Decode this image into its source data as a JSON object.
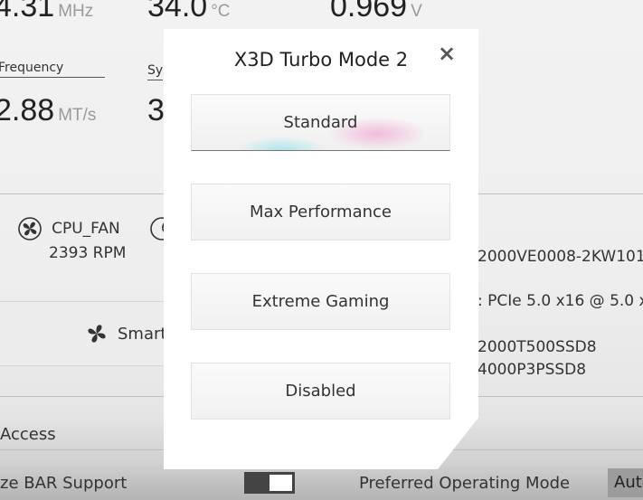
{
  "background": {
    "top_values": [
      {
        "value": "4.31",
        "unit": "MHz"
      },
      {
        "value": "34.0",
        "unit": "°C"
      },
      {
        "value": "0.969",
        "unit": "V"
      }
    ],
    "frequency_label": "Frequency",
    "frequency_value": "2.88",
    "frequency_unit": "MT/s",
    "sy_label": "Sy",
    "sy_value": "3",
    "fan": {
      "name": "CPU_FAN",
      "rpm": "2393 RPM"
    },
    "storage": {
      "line1": "2000VE0008-2KW101",
      "line2": ": PCIe 5.0 x16 @ 5.0 x",
      "line3": "2000T500SSD8",
      "line4": "4000P3PSSD8"
    },
    "smart_fan_label": "Smart",
    "access_label": "Access",
    "resize_bar_label": "ze BAR Support",
    "preferred_mode_label": "Preferred Operating Mode",
    "preferred_mode_value": "Auto"
  },
  "dialog": {
    "title": "X3D Turbo Mode 2",
    "close_glyph": "×",
    "options": [
      {
        "label": "Standard",
        "selected": true
      },
      {
        "label": "Max Performance",
        "selected": false
      },
      {
        "label": "Extreme Gaming",
        "selected": false
      },
      {
        "label": "Disabled",
        "selected": false
      }
    ]
  }
}
